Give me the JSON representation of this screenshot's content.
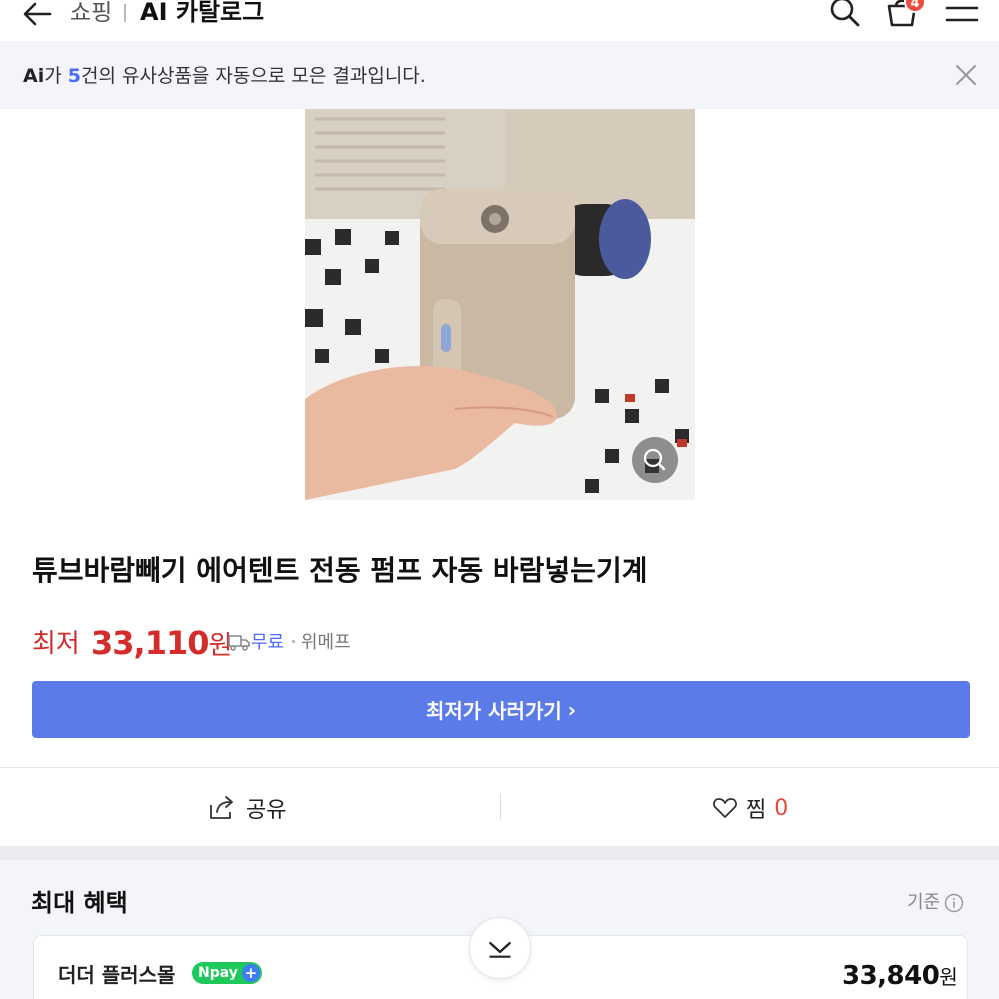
{
  "header": {
    "shop_label": "쇼핑",
    "title": "AI 카탈로그",
    "cart_count": "4"
  },
  "notice": {
    "ai_label": "Ai",
    "prefix": "가 ",
    "count": "5",
    "suffix": "건의 유사상품을 자동으로 모은 결과입니다."
  },
  "product": {
    "title": "튜브바람빼기 에어텐트 전동 펌프 자동 바람넣는기계",
    "price_label": "최저",
    "price": "33,110",
    "price_unit": "원",
    "delivery": "무료",
    "seller": "위메프"
  },
  "buy_button": {
    "label": "최저가 사러가기",
    "arrow": "›"
  },
  "actions": {
    "share_label": "공유",
    "like_label": "찜",
    "like_count": "0"
  },
  "benefit": {
    "title": "최대 혜택",
    "basis_label": "기준",
    "store_name": "더더 플러스몰",
    "npay_label": "Npay",
    "npay_plus": "+",
    "price": "33,840",
    "price_unit": "원"
  },
  "colors": {
    "accent_blue": "#5b7be8",
    "price_red": "#d42b2b",
    "npay_green": "#1fc85a"
  },
  "icons": [
    "back-arrow-icon",
    "search-icon",
    "cart-icon",
    "menu-icon",
    "close-icon",
    "zoom-icon",
    "delivery-truck-icon",
    "share-icon",
    "heart-icon",
    "info-icon",
    "chevron-down-icon"
  ]
}
